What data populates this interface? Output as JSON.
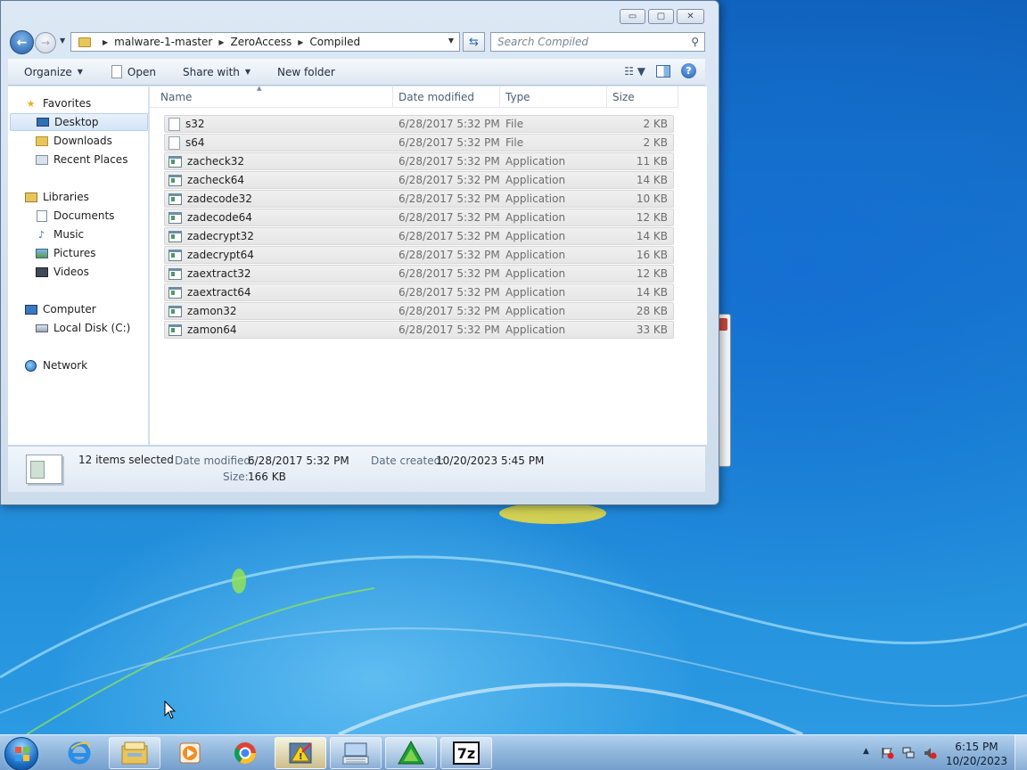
{
  "window": {
    "caption_buttons": {
      "minimize": "▭",
      "maximize": "▢",
      "close": "✕"
    }
  },
  "address": {
    "crumbs": [
      "malware-1-master",
      "ZeroAccess",
      "Compiled"
    ],
    "search_placeholder": "Search Compiled"
  },
  "toolbar": {
    "organize": "Organize",
    "open": "Open",
    "share_with": "Share with",
    "new_folder": "New folder"
  },
  "nav": {
    "favorites": "Favorites",
    "desktop": "Desktop",
    "downloads": "Downloads",
    "recent_places": "Recent Places",
    "libraries": "Libraries",
    "documents": "Documents",
    "music": "Music",
    "pictures": "Pictures",
    "videos": "Videos",
    "computer": "Computer",
    "local_disk": "Local Disk (C:)",
    "network": "Network"
  },
  "columns": {
    "name": "Name",
    "date": "Date modified",
    "type": "Type",
    "size": "Size"
  },
  "files": [
    {
      "name": "s32",
      "date": "6/28/2017 5:32 PM",
      "type": "File",
      "size": "2 KB",
      "icon": "doc"
    },
    {
      "name": "s64",
      "date": "6/28/2017 5:32 PM",
      "type": "File",
      "size": "2 KB",
      "icon": "doc"
    },
    {
      "name": "zacheck32",
      "date": "6/28/2017 5:32 PM",
      "type": "Application",
      "size": "11 KB",
      "icon": "app"
    },
    {
      "name": "zacheck64",
      "date": "6/28/2017 5:32 PM",
      "type": "Application",
      "size": "14 KB",
      "icon": "app"
    },
    {
      "name": "zadecode32",
      "date": "6/28/2017 5:32 PM",
      "type": "Application",
      "size": "10 KB",
      "icon": "app"
    },
    {
      "name": "zadecode64",
      "date": "6/28/2017 5:32 PM",
      "type": "Application",
      "size": "12 KB",
      "icon": "app"
    },
    {
      "name": "zadecrypt32",
      "date": "6/28/2017 5:32 PM",
      "type": "Application",
      "size": "14 KB",
      "icon": "app"
    },
    {
      "name": "zadecrypt64",
      "date": "6/28/2017 5:32 PM",
      "type": "Application",
      "size": "16 KB",
      "icon": "app"
    },
    {
      "name": "zaextract32",
      "date": "6/28/2017 5:32 PM",
      "type": "Application",
      "size": "12 KB",
      "icon": "app"
    },
    {
      "name": "zaextract64",
      "date": "6/28/2017 5:32 PM",
      "type": "Application",
      "size": "14 KB",
      "icon": "app"
    },
    {
      "name": "zamon32",
      "date": "6/28/2017 5:32 PM",
      "type": "Application",
      "size": "28 KB",
      "icon": "app"
    },
    {
      "name": "zamon64",
      "date": "6/28/2017 5:32 PM",
      "type": "Application",
      "size": "33 KB",
      "icon": "app"
    }
  ],
  "details": {
    "count": "12 items selected",
    "modified_label": "Date modified:",
    "modified_value": "6/28/2017 5:32 PM",
    "created_label": "Date created:",
    "created_value": "10/20/2023 5:45 PM",
    "size_label": "Size:",
    "size_value": "166 KB"
  },
  "taskbar": {
    "apps": [
      "internet-explorer-icon",
      "windows-explorer-icon",
      "media-player-icon",
      "chrome-icon",
      "warning-app-icon",
      "keyboard-app-icon",
      "green-triangle-app-icon",
      "7zip-icon"
    ],
    "sevenzip_label": "7z",
    "time": "6:15 PM",
    "date": "10/20/2023"
  },
  "colors": {
    "accent": "#1d6fc7",
    "selection": "#e6e6e6"
  }
}
